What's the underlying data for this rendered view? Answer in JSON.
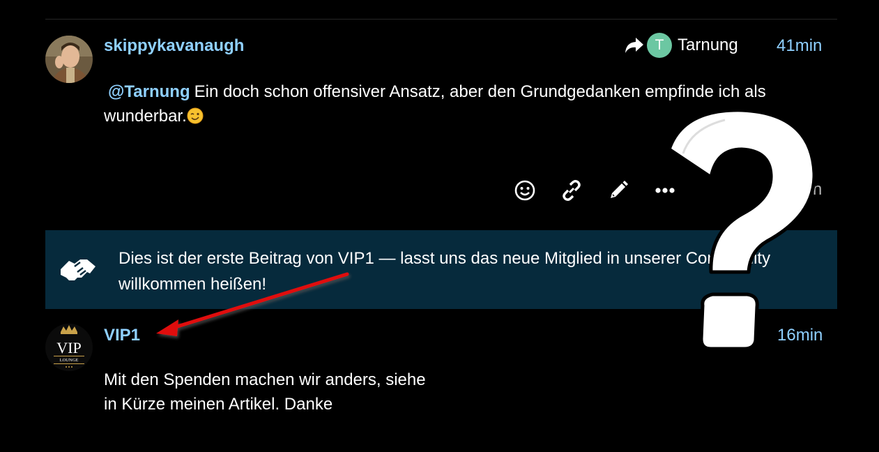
{
  "post1": {
    "username": "skippykavanaugh",
    "reply_to_initial": "T",
    "reply_to_name": "Tarnung",
    "time": "41min",
    "mention": "@Tarnung",
    "text_line1": "Ein doch schon offensiver Ansatz, aber den Grundgedanken empfinde ich als",
    "text_line2": "wunderbar.",
    "actions": [
      "smile-icon",
      "link-icon",
      "pencil-icon",
      "ellipsis-icon"
    ],
    "action_partial_text": "n"
  },
  "notice": {
    "text_line1": "Dies ist der erste Beitrag von VIP1 — lasst uns das neue Mitglied in unserer Community",
    "text_line2": "willkommen heißen!"
  },
  "post2": {
    "username": "VIP1",
    "time": "16min",
    "avatar_text": "VIP",
    "avatar_subtext": "LOUNGE",
    "text_line1": "Mit den Spenden machen wir anders, siehe",
    "text_line2": "in Kürze meinen Artikel. Danke"
  },
  "colors": {
    "background": "#000000",
    "username": "#8fd0ff",
    "notice_bg": "#062a3c",
    "reply_avatar": "#6cc7a2",
    "annotation_arrow": "#e01010"
  }
}
